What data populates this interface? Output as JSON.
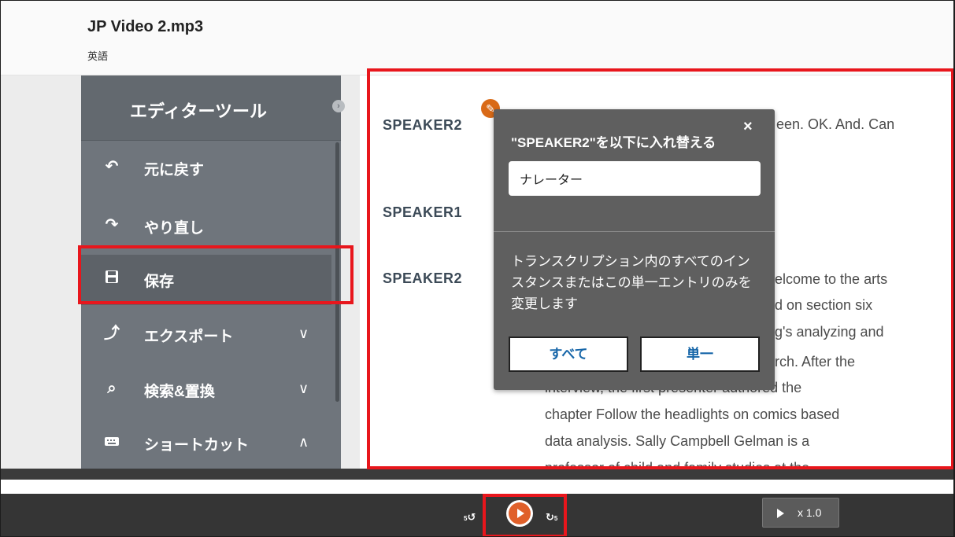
{
  "header": {
    "file_title": "JP Video 2.mp3",
    "language": "英語"
  },
  "sidebar": {
    "title": "エディターツール",
    "items": [
      {
        "label": "元に戻す",
        "icon": "undo-icon"
      },
      {
        "label": "やり直し",
        "icon": "redo-icon"
      },
      {
        "label": "保存",
        "icon": "save-icon"
      },
      {
        "label": "エクスポート",
        "icon": "export-icon",
        "chevron": "down"
      },
      {
        "label": "検索&置換",
        "icon": "search-replace-icon",
        "chevron": "down"
      },
      {
        "label": "ショートカット",
        "icon": "keyboard-icon",
        "chevron": "up"
      }
    ]
  },
  "transcript": {
    "speakers": [
      "SPEAKER2",
      "SPEAKER1",
      "SPEAKER2"
    ],
    "lines": [
      "een. OK. And. Can",
      "elcome to the arts",
      "d on section six",
      "g's analyzing and",
      "rch. After the",
      "interview, the first presenter authored the",
      "chapter Follow the headlights on comics based",
      "data analysis. Sally Campbell Gelman is a",
      "professor of child and family studies at the"
    ]
  },
  "popup": {
    "title": "\"SPEAKER2\"を以下に入れ替える",
    "close": "×",
    "input_value": "ナレーター",
    "description": "トランスクリプション内のすべてのインスタンスまたはこの単一エントリのみを変更します",
    "btn_all": "すべて",
    "btn_single": "単一"
  },
  "player": {
    "rewind_label": "5",
    "forward_label": "5",
    "speed": "x 1.0"
  },
  "colors": {
    "accent_red": "#e8161c",
    "play_orange": "#e0602a",
    "sidebar_bg": "#6f757c",
    "popup_bg": "#5f5f5f",
    "button_text": "#1565a8"
  }
}
